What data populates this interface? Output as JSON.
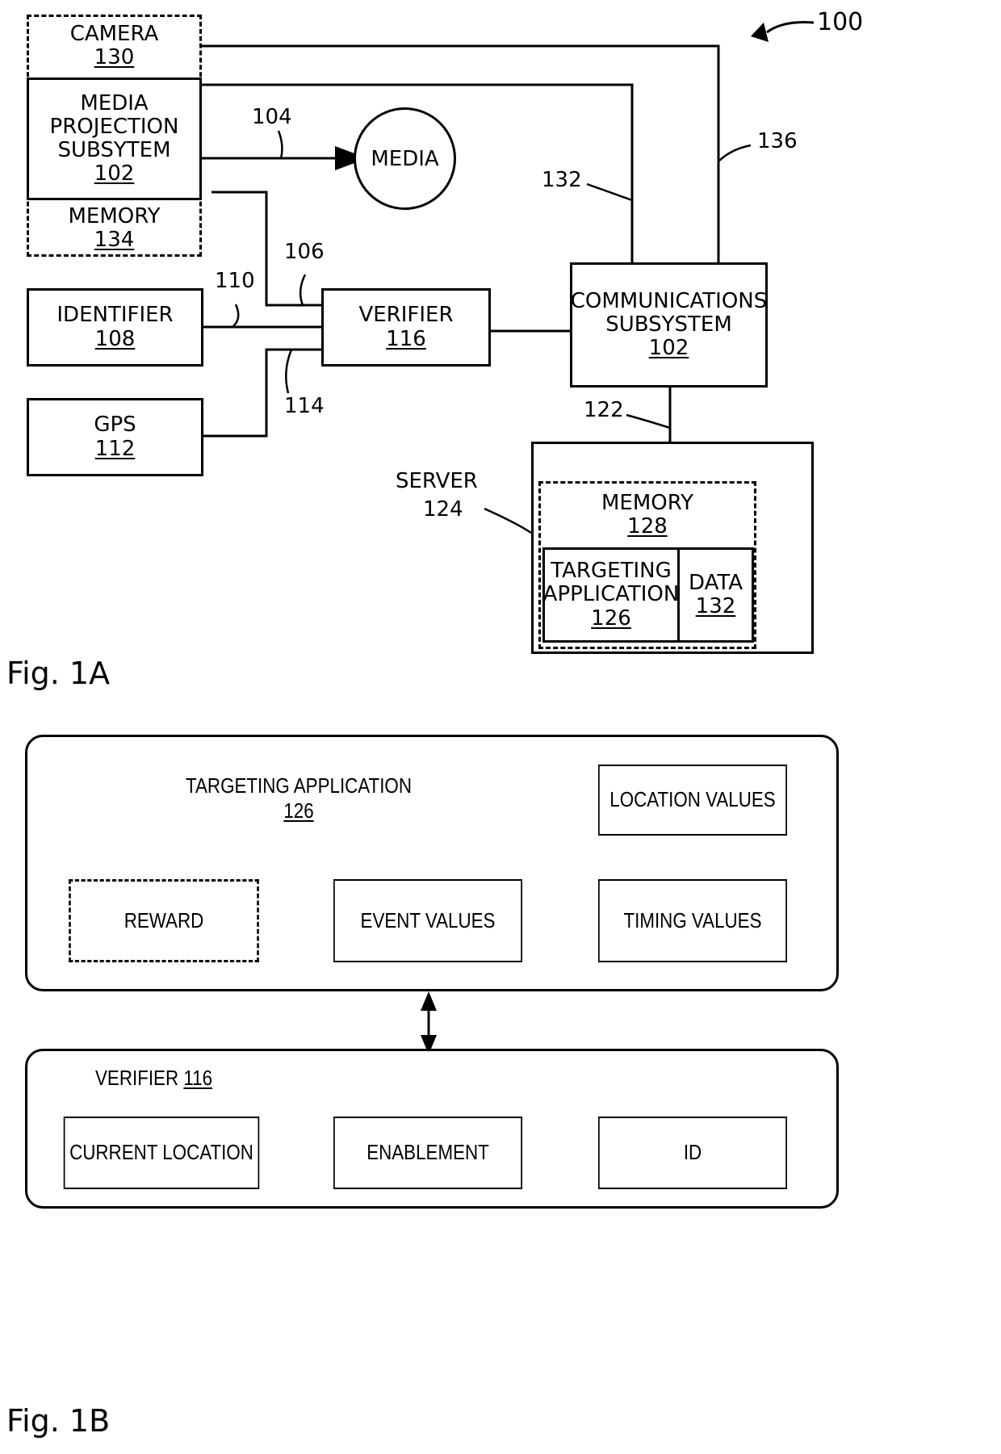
{
  "figure_1a": {
    "label": "Fig. 1A",
    "system_ref": "100",
    "blocks": {
      "camera": {
        "label": "CAMERA",
        "num": "130"
      },
      "media_projection": {
        "label": "MEDIA\nPROJECTION\nSUBSYTEM",
        "line1": "MEDIA",
        "line2": "PROJECTION",
        "line3": "SUBSYTEM",
        "num": "102"
      },
      "memory_device": {
        "label": "MEMORY",
        "num": "134"
      },
      "identifier": {
        "label": "IDENTIFIER",
        "num": "108"
      },
      "gps": {
        "label": "GPS",
        "num": "112"
      },
      "verifier": {
        "label": "VERIFIER",
        "num": "116"
      },
      "media": {
        "label": "MEDIA"
      },
      "communications": {
        "line1": "COMMUNICATIONS",
        "line2": "SUBSYSTEM",
        "num": "102"
      },
      "server": {
        "label": "SERVER",
        "num": "124"
      },
      "server_memory": {
        "label": "MEMORY",
        "num": "128"
      },
      "targeting_application": {
        "line1": "TARGETING",
        "line2": "APPLICATION",
        "num": "126"
      },
      "data": {
        "label": "DATA",
        "num": "132"
      }
    },
    "connector_refs": {
      "media_link": "104",
      "projection_to_verifier": "106",
      "identifier_to_verifier": "110",
      "gps_to_verifier": "114",
      "comms_to_server": "122",
      "comms_data_link": "132",
      "camera_link": "136"
    }
  },
  "figure_1b": {
    "label": "Fig. 1B",
    "targeting_panel": {
      "title_line1": "TARGETING APPLICATION",
      "title_num": "126",
      "boxes": [
        {
          "label": "LOCATION VALUES",
          "style": "solid"
        },
        {
          "label": "REWARD",
          "style": "dashed"
        },
        {
          "label": "EVENT VALUES",
          "style": "solid"
        },
        {
          "label": "TIMING VALUES",
          "style": "solid"
        }
      ]
    },
    "verifier_panel": {
      "title_label": "VERIFIER",
      "title_num": "116",
      "boxes": [
        {
          "label": "CURRENT LOCATION",
          "style": "solid"
        },
        {
          "label": "ENABLEMENT",
          "style": "solid"
        },
        {
          "label": "ID",
          "style": "solid"
        }
      ]
    },
    "connector": {
      "type": "double-arrow"
    }
  },
  "colors": {
    "ink": "#000000",
    "paper": "#ffffff"
  }
}
